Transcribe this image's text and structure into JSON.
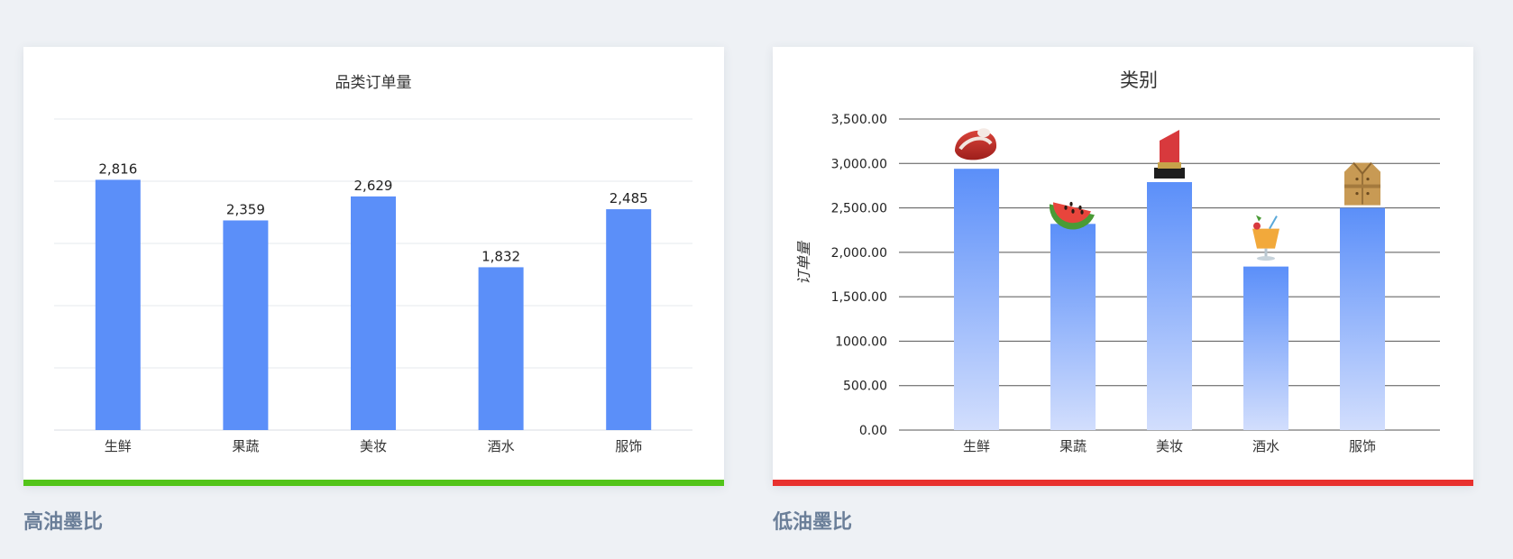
{
  "chart_data": [
    {
      "type": "bar",
      "title": "品类订单量",
      "categories": [
        "生鲜",
        "果蔬",
        "美妆",
        "酒水",
        "服饰"
      ],
      "values": [
        2816,
        2359,
        2629,
        1832,
        2485
      ],
      "data_labels": [
        "2,816",
        "2,359",
        "2,629",
        "1,832",
        "2,485"
      ],
      "ylim": [
        0,
        3500
      ],
      "grid": true,
      "bar_color": "#5b8ff9",
      "accent_color": "#52c41a"
    },
    {
      "type": "bar",
      "title": "类别",
      "ylabel": "订单量",
      "categories": [
        "生鲜",
        "果蔬",
        "美妆",
        "酒水",
        "服饰"
      ],
      "values": [
        2940,
        2320,
        2790,
        1840,
        2500
      ],
      "y_ticks": [
        "0.00",
        "500.00",
        "1000.00",
        "1,500.00",
        "2,000.00",
        "2,500.00",
        "3,000.00",
        "3,500.00"
      ],
      "ylim": [
        0,
        3500
      ],
      "grid": true,
      "bar_gradient": [
        "#5b8ff9",
        "#d2defd"
      ],
      "icons": [
        "meat-icon",
        "watermelon-icon",
        "lipstick-icon",
        "cocktail-icon",
        "coat-icon"
      ],
      "accent_color": "#e8312f"
    }
  ],
  "captions": {
    "left": "高油墨比",
    "right": "低油墨比"
  }
}
